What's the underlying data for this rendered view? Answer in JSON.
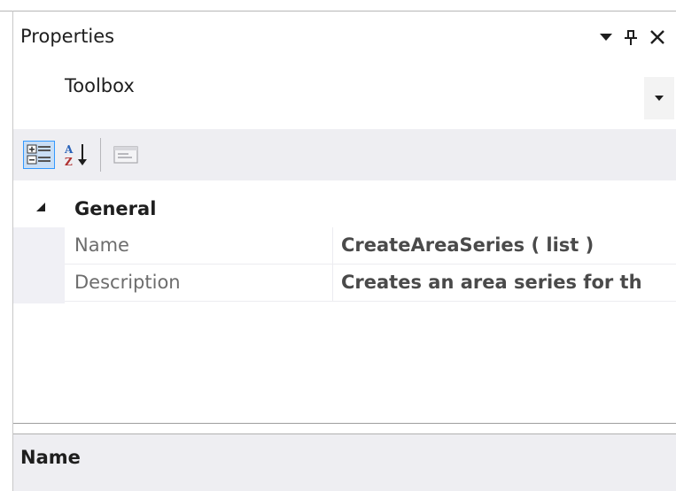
{
  "panel": {
    "title": "Properties",
    "buttons": {
      "dropdown": "window-position-dropdown-icon",
      "pin": "pin-icon",
      "close": "close-icon"
    }
  },
  "selector": {
    "value": "Toolbox"
  },
  "toolbar": {
    "categorized": "categorized-view-icon",
    "alphabetical": "alphabetical-sort-icon",
    "property_pages": "property-pages-icon"
  },
  "grid": {
    "category": "General",
    "properties": [
      {
        "name": "Name",
        "value": "CreateAreaSeries ( list )"
      },
      {
        "name": "Description",
        "value": "Creates an area series for th"
      }
    ]
  },
  "description": {
    "title": "Name"
  },
  "colors": {
    "toolbar_bg": "#eeeef2",
    "selected_border": "#3399ff",
    "selected_fill": "#c9def5",
    "gutter_bg": "#f0f0f5"
  }
}
